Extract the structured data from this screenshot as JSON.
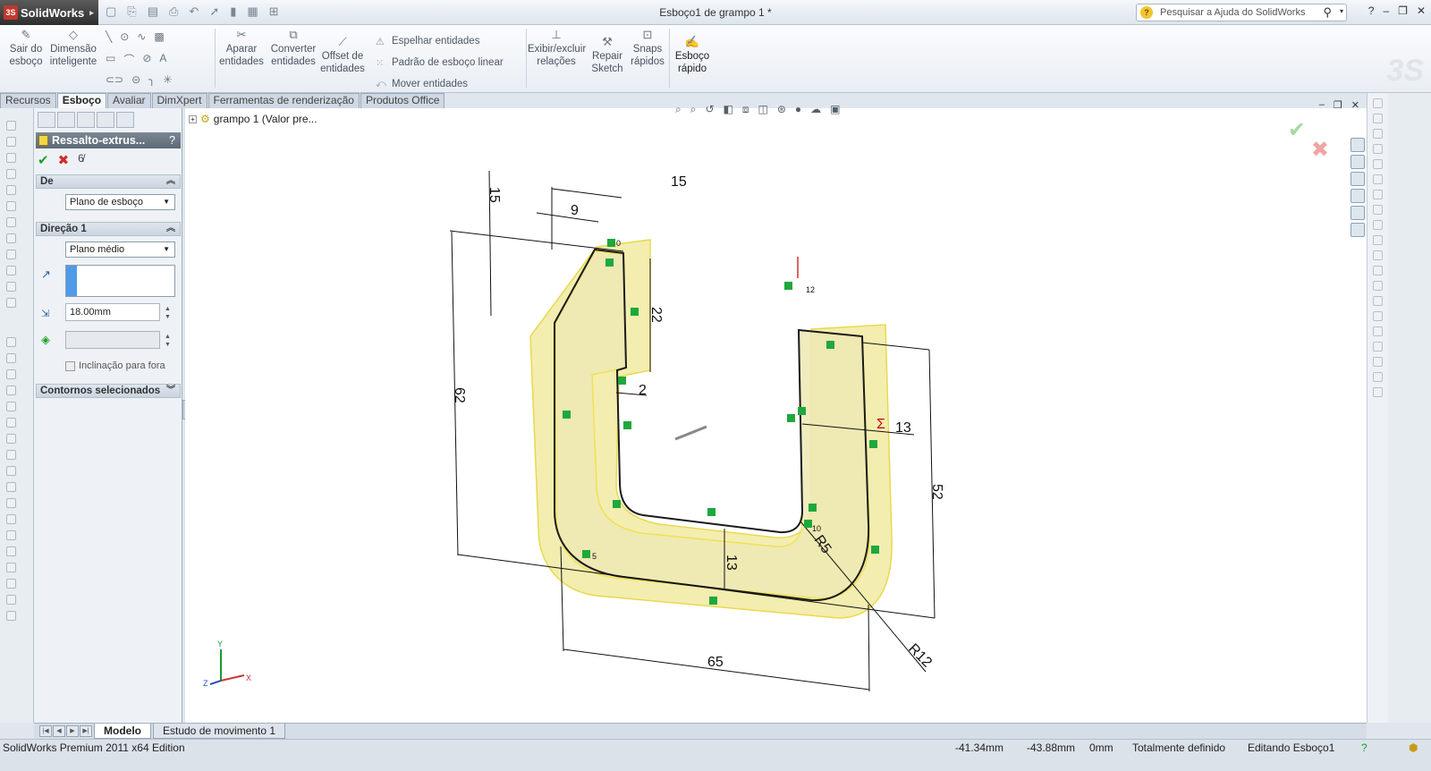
{
  "app": {
    "logo": "SolidWorks",
    "doc_title": "Esboço1 de grampo 1 *"
  },
  "search": {
    "placeholder": "Pesquisar a Ajuda do SolidWorks"
  },
  "ribbon": {
    "sair": "Sair do esboço",
    "dimensao": "Dimensão inteligente",
    "aparar": "Aparar entidades",
    "converter": "Converter entidades",
    "offset": "Offset de entidades",
    "espelhar": "Espelhar entidades",
    "padrao": "Padrão de esboço linear",
    "mover": "Mover entidades",
    "exibir": "Exibir/excluir relações",
    "repair": "Repair Sketch",
    "snaps": "Snaps rápidos",
    "esboco_rapido": "Esboço rápido"
  },
  "tabs": [
    "Recursos",
    "Esboço",
    "Avaliar",
    "DimXpert",
    "Ferramentas de renderização",
    "Produtos Office"
  ],
  "property_manager": {
    "title": "Ressalto-extrus...",
    "help": "?",
    "de_label": "De",
    "de_value": "Plano de esboço",
    "direcao_label": "Direção 1",
    "direcao_value": "Plano médio",
    "depth": "18.00mm",
    "draft_label": "Inclinação para fora",
    "contornos_label": "Contornos selecionados"
  },
  "tree": {
    "item": "grampo 1  (Valor pre..."
  },
  "dimensions": {
    "d15_top": "15",
    "d15_side": "15",
    "d9": "9",
    "d22": "22",
    "d2": "2",
    "d62": "62",
    "d13_right": "13",
    "d52": "52",
    "d13_bottom": "13",
    "d65": "65",
    "r5": "R5",
    "r12": "R12",
    "rel_12": "12",
    "rel_10": "10",
    "rel_5": "5",
    "rel_0": "0"
  },
  "bottom_tabs": [
    "Modelo",
    "Estudo de movimento 1"
  ],
  "status": {
    "edition": "SolidWorks Premium 2011 x64 Edition",
    "x": "-41.34mm",
    "y": "-43.88mm",
    "z": "0mm",
    "state": "Totalmente definido",
    "editing": "Editando Esboço1"
  },
  "colors": {
    "part_fill": "#f2eca8",
    "sketch": "#1a1a1a",
    "relation": "#1fa83c"
  }
}
